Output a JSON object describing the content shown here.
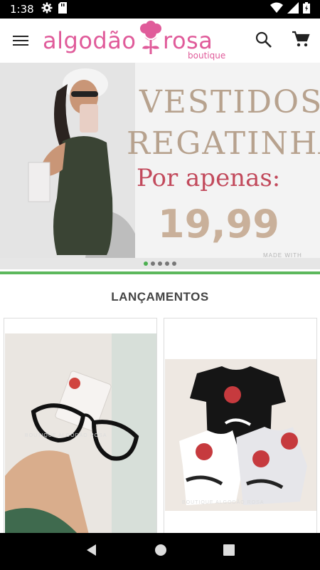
{
  "status_bar": {
    "time": "1:38",
    "icons": [
      "gear-icon",
      "sd-card-icon",
      "wifi-icon",
      "signal-icon",
      "battery-icon"
    ]
  },
  "app_bar": {
    "logo_left": "algodão",
    "logo_right": "rosa",
    "logo_tagline": "boutique",
    "icons": [
      "menu-icon",
      "search-icon",
      "cart-icon"
    ],
    "brand_color": "#e05b9a"
  },
  "banner": {
    "line1": "VESTIDOS",
    "line2": "REGATINHA",
    "line3": "Por apenas:",
    "price": "19,99",
    "watermark": "MADE WITH",
    "dots_count": 5,
    "active_dot": 0
  },
  "section": {
    "title": "LANÇAMENTOS"
  },
  "products": [
    {
      "image": "glasses-photo",
      "watermark": "BOUTIQUE ALGODÃO ROSA"
    },
    {
      "image": "tshirts-photo",
      "watermark": "BOUTIQUE ALGODÃO ROSA"
    }
  ],
  "nav_bar": {
    "icons": [
      "back-icon",
      "home-icon",
      "recents-icon"
    ]
  },
  "colors": {
    "accent_green": "#5cb85c",
    "banner_text": "#b7a28e",
    "banner_subtitle": "#c24a5c"
  }
}
